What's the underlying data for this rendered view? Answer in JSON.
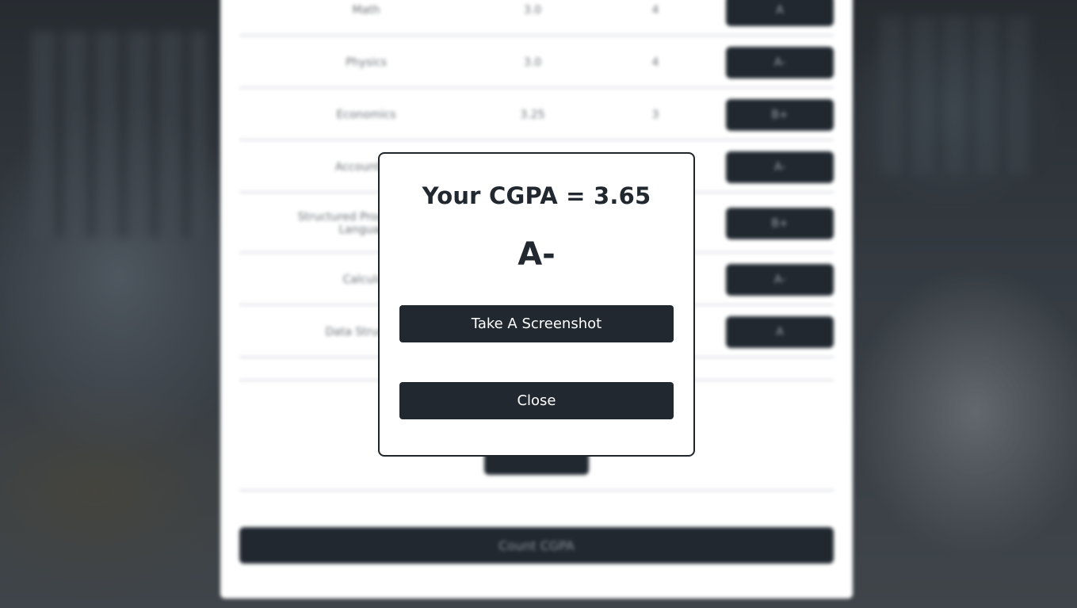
{
  "modal": {
    "title": "Your CGPA = 3.65",
    "grade": "A-",
    "screenshot_label": "Take A Screenshot",
    "close_label": "Close"
  },
  "background_table": {
    "rows": [
      {
        "course": "Math",
        "credit": "3.0",
        "point": "4",
        "grade": "A"
      },
      {
        "course": "Physics",
        "credit": "3.0",
        "point": "4",
        "grade": "A-"
      },
      {
        "course": "Economics",
        "credit": "3.25",
        "point": "3",
        "grade": "B+"
      },
      {
        "course": "Accounting",
        "credit": "",
        "point": "",
        "grade": "A-"
      },
      {
        "course": "Structured Programming Language",
        "credit": "",
        "point": "",
        "grade": "B+"
      },
      {
        "course": "Calculus",
        "credit": "",
        "point": "",
        "grade": "A-"
      },
      {
        "course": "Data Structure",
        "credit": "",
        "point": "",
        "grade": "A"
      }
    ],
    "count_label": "Count CGPA"
  },
  "colors": {
    "primary": "#212830",
    "modal_bg": "#ffffff",
    "divider": "#e5e7e9"
  }
}
